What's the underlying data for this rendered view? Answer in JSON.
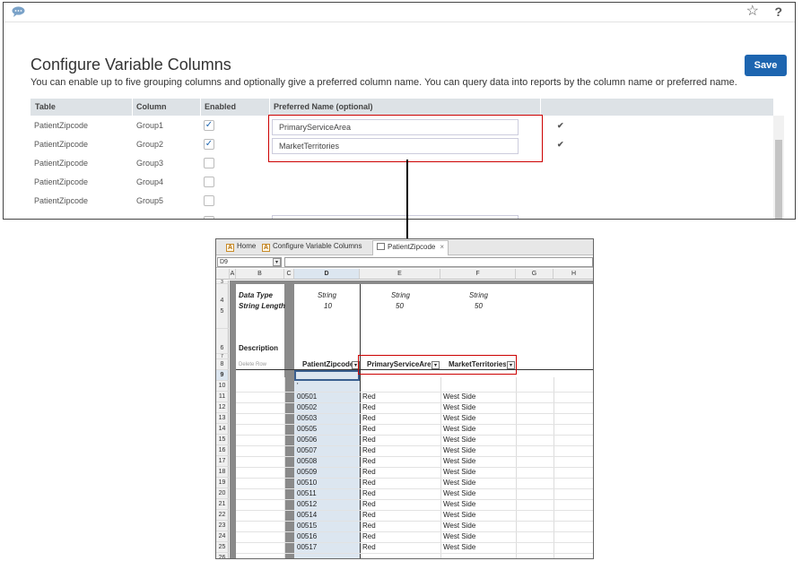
{
  "app": {
    "title": "Configure Variable Columns",
    "subtitle": "You can enable up to five grouping columns and optionally give a preferred column name. You can query data into reports by the column name or preferred name.",
    "save_label": "Save",
    "favorite_glyph": "☆",
    "help_glyph": "?",
    "icons": [
      "chat-icon",
      "star-icon",
      "help-icon",
      "checkmark-icon"
    ],
    "accent_color": "#1d65b0",
    "columns": {
      "table": "Table",
      "column": "Column",
      "enabled": "Enabled",
      "preferred": "Preferred Name (optional)"
    },
    "rows": [
      {
        "table": "PatientZipcode",
        "column": "Group1",
        "enabled": true,
        "preferred": "PrimaryServiceArea"
      },
      {
        "table": "PatientZipcode",
        "column": "Group2",
        "enabled": true,
        "preferred": "MarketTerritories"
      },
      {
        "table": "PatientZipcode",
        "column": "Group3",
        "enabled": false,
        "preferred": ""
      },
      {
        "table": "PatientZipcode",
        "column": "Group4",
        "enabled": false,
        "preferred": ""
      },
      {
        "table": "PatientZipcode",
        "column": "Group5",
        "enabled": false,
        "preferred": ""
      }
    ],
    "check_glyph": "✓",
    "ok_glyph": "✔"
  },
  "sheet": {
    "tabs": [
      {
        "label": "Home",
        "icon": "a-icon"
      },
      {
        "label": "Configure Variable Columns",
        "icon": "a-icon"
      },
      {
        "label": "PatientZipcode",
        "icon": "grid-icon",
        "active": true
      }
    ],
    "tab_icon_letter": "A",
    "close_glyph": "×",
    "dropdown_glyph": "▾",
    "name_box": "D9",
    "col_headers": [
      "A",
      "B",
      "C",
      "D",
      "E",
      "F",
      "G",
      "H"
    ],
    "meta": {
      "data_type_label": "Data Type",
      "string_length_label": "String Length",
      "description_label": "Description",
      "delete_row_label": "Delete Row",
      "d": {
        "type": "String",
        "length": "10"
      },
      "e": {
        "type": "String",
        "length": "50"
      },
      "f": {
        "type": "String",
        "length": "50"
      }
    },
    "headers": {
      "d": "PatientZipcode",
      "e": "PrimaryServiceArea",
      "f": "MarketTerritories"
    },
    "row_numbers": [
      "3",
      "4",
      "5",
      "6",
      "7",
      "8",
      "9",
      "10",
      "11",
      "12",
      "13",
      "14",
      "15",
      "16",
      "17",
      "18",
      "19",
      "20",
      "21",
      "22",
      "23",
      "24",
      "25",
      "26"
    ],
    "row10_d": "'",
    "data_rows": [
      {
        "zip": "00501",
        "area": "Red",
        "territory": "West Side"
      },
      {
        "zip": "00502",
        "area": "Red",
        "territory": "West Side"
      },
      {
        "zip": "00503",
        "area": "Red",
        "territory": "West Side"
      },
      {
        "zip": "00505",
        "area": "Red",
        "territory": "West Side"
      },
      {
        "zip": "00506",
        "area": "Red",
        "territory": "West Side"
      },
      {
        "zip": "00507",
        "area": "Red",
        "territory": "West Side"
      },
      {
        "zip": "00508",
        "area": "Red",
        "territory": "West Side"
      },
      {
        "zip": "00509",
        "area": "Red",
        "territory": "West Side"
      },
      {
        "zip": "00510",
        "area": "Red",
        "territory": "West Side"
      },
      {
        "zip": "00511",
        "area": "Red",
        "territory": "West Side"
      },
      {
        "zip": "00512",
        "area": "Red",
        "territory": "West Side"
      },
      {
        "zip": "00514",
        "area": "Red",
        "territory": "West Side"
      },
      {
        "zip": "00515",
        "area": "Red",
        "territory": "West Side"
      },
      {
        "zip": "00516",
        "area": "Red",
        "territory": "West Side"
      },
      {
        "zip": "00517",
        "area": "Red",
        "territory": "West Side"
      }
    ],
    "highlight_color": "#cc0000"
  }
}
